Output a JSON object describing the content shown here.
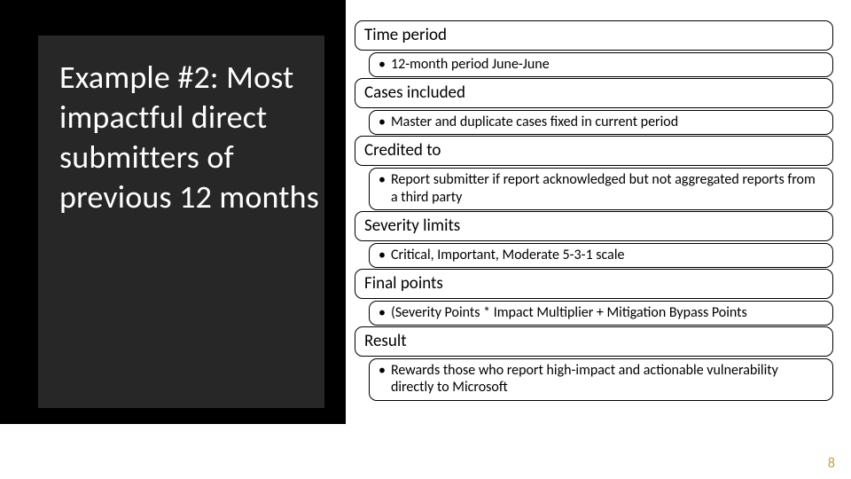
{
  "title": "Example #2: Most impactful direct submitters of previous 12 months",
  "sections": [
    {
      "header": "Time period",
      "bullet": "12-month period June-June"
    },
    {
      "header": "Cases included",
      "bullet": "Master and duplicate cases fixed in current period"
    },
    {
      "header": "Credited to",
      "bullet": "Report submitter if report acknowledged but not aggregated reports from a third party"
    },
    {
      "header": "Severity limits",
      "bullet": "Critical, Important, Moderate 5-3-1 scale"
    },
    {
      "header": "Final points",
      "bullet": "(Severity Points * Impact Multiplier + Mitigation Bypass Points"
    },
    {
      "header": "Result",
      "bullet": "Rewards those who report high-impact and actionable vulnerability directly to Microsoft"
    }
  ],
  "page_number": "8"
}
